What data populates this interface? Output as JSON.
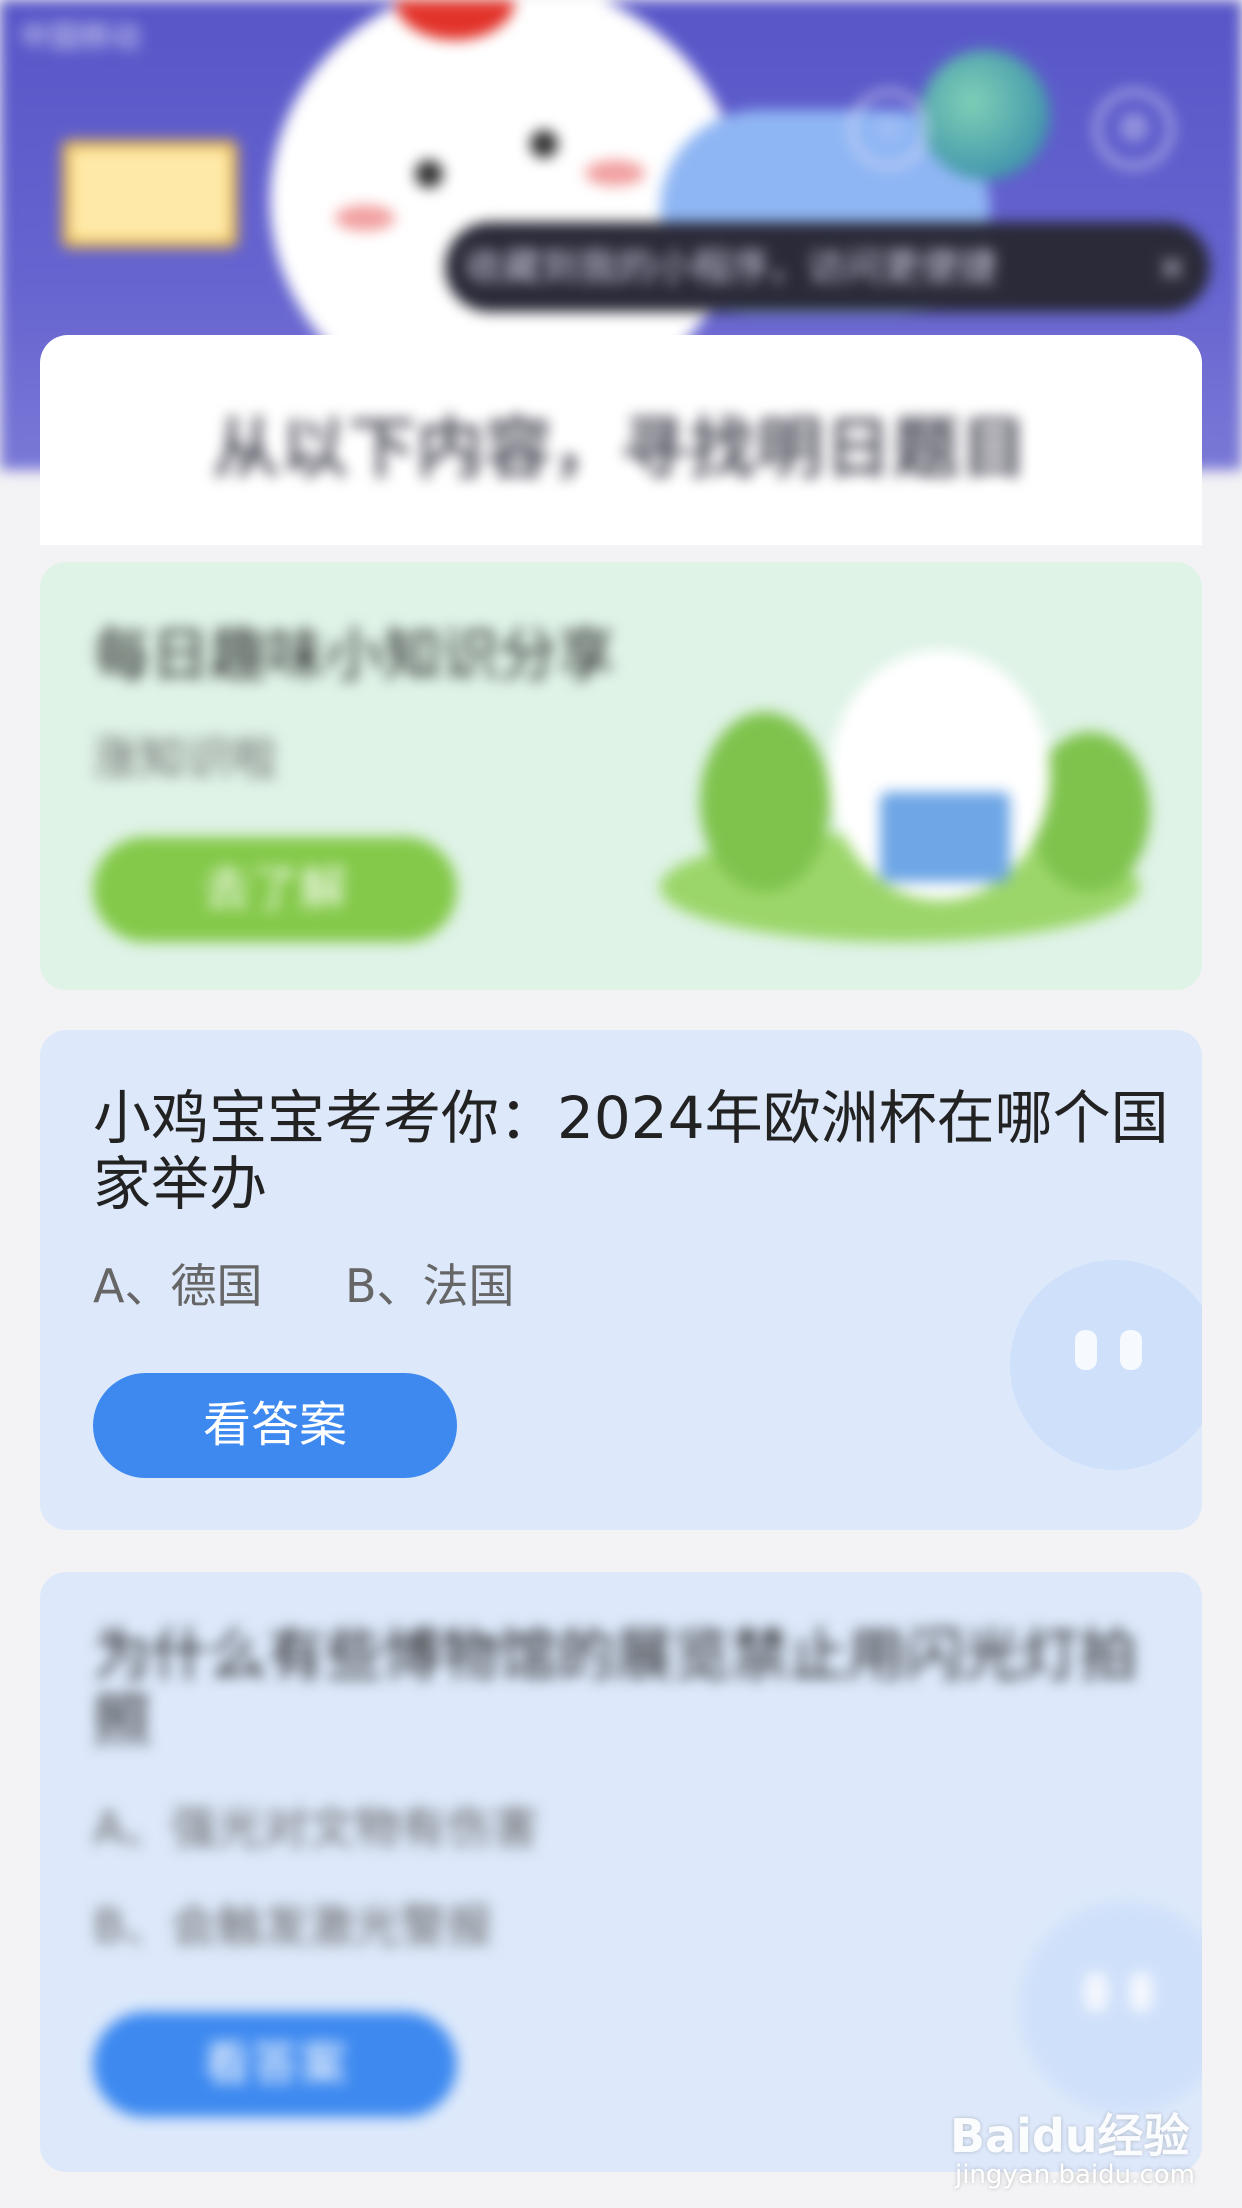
{
  "status_bar": {
    "carrier": "中国移动",
    "time": ""
  },
  "toast": {
    "text": "收藏到我的小程序，访问更便捷 ",
    "close_label": "×"
  },
  "section_title": "从以下内容，寻找明日题目",
  "knowledge_card": {
    "title": "每日趣味小知识分享",
    "subtitle": "涨知识啦",
    "button_label": "去了解"
  },
  "quiz_cards": [
    {
      "question": "小鸡宝宝考考你：2024年欧洲杯在哪个国家举办",
      "options": [
        "A、德国",
        "B、法国"
      ],
      "button_label": "看答案"
    },
    {
      "question": "为什么有些博物馆的展览禁止用闪光灯拍照",
      "options": [
        "A、强光对文物有伤害",
        "B、会触发激光警报"
      ],
      "button_label": "看答案"
    }
  ],
  "watermark": {
    "brand": "Baidu经验",
    "url": "jingyan.baidu.com"
  },
  "colors": {
    "header": "#5856c8",
    "green_button": "#84c94a",
    "blue_button": "#3d89f0",
    "green_card": "#dff3e7",
    "blue_card": "#dde9fb"
  }
}
